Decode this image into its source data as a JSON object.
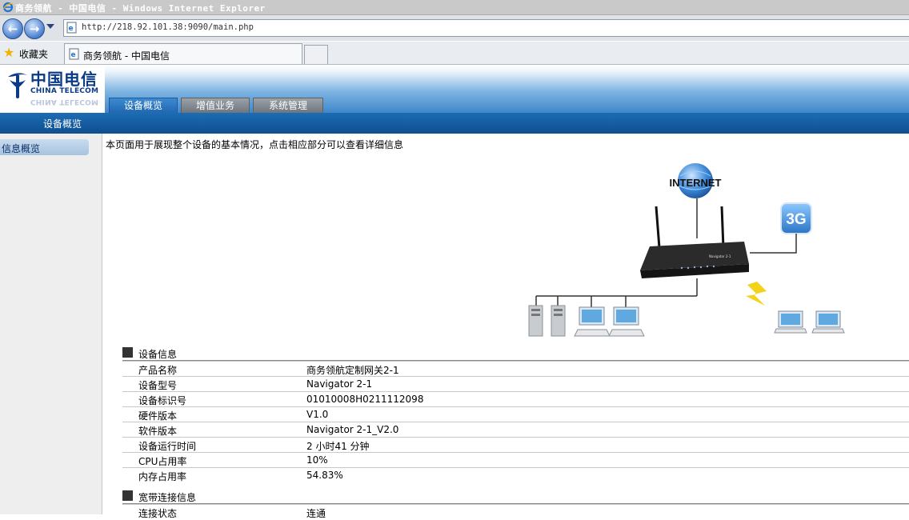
{
  "window": {
    "title": "商务领航 - 中国电信 - Windows Internet Explorer"
  },
  "address": {
    "url": "http://218.92.101.38:9090/main.php"
  },
  "favorites": {
    "label": "收藏夹"
  },
  "browser_tab": {
    "label": "商务领航 - 中国电信"
  },
  "logo": {
    "cn": "中国电信",
    "en": "CHINA TELECOM"
  },
  "nav": {
    "tabs": [
      {
        "label": "设备概览",
        "active": true
      },
      {
        "label": "增值业务",
        "active": false
      },
      {
        "label": "系统管理",
        "active": false
      }
    ]
  },
  "subnav": {
    "label": "设备概览"
  },
  "sidebar": {
    "items": [
      {
        "label": "信息概览"
      }
    ]
  },
  "intro": "本页面用于展现整个设备的基本情况，点击相应部分可以查看详细信息",
  "diagram": {
    "internet_label": "INTERNET",
    "badge_3g": "3G",
    "router_model": "Navigator 2-1"
  },
  "device_info": {
    "title": "设备信息",
    "rows": [
      {
        "key": "产品名称",
        "value": "商务领航定制网关2-1"
      },
      {
        "key": "设备型号",
        "value": "Navigator 2-1"
      },
      {
        "key": "设备标识号",
        "value": "01010008H0211112098"
      },
      {
        "key": "硬件版本",
        "value": "V1.0"
      },
      {
        "key": "软件版本",
        "value": "Navigator 2-1_V2.0"
      },
      {
        "key": "设备运行时间",
        "value": "2 小时41 分钟"
      },
      {
        "key": "CPU占用率",
        "value": "10%"
      },
      {
        "key": "内存占用率",
        "value": "54.83%"
      }
    ]
  },
  "broadband_info": {
    "title": "宽带连接信息",
    "rows": [
      {
        "key": "连接状态",
        "value": "连通"
      }
    ]
  }
}
